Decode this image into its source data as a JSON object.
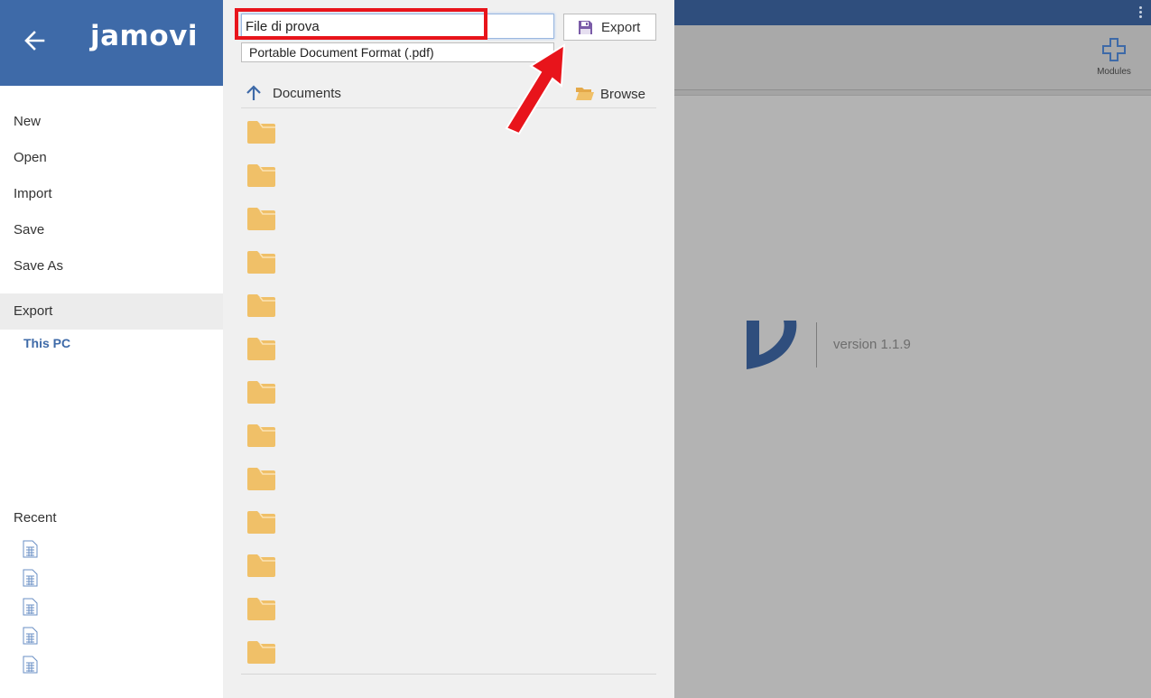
{
  "app": {
    "brand": "jamovi",
    "version": "version 1.1.9",
    "modules_label": "Modules"
  },
  "sidebar": {
    "menu": [
      {
        "label": "New"
      },
      {
        "label": "Open"
      },
      {
        "label": "Import"
      },
      {
        "label": "Save"
      },
      {
        "label": "Save As"
      }
    ],
    "export_label": "Export",
    "this_pc_label": "This PC",
    "recent_title": "Recent"
  },
  "export_panel": {
    "filename_value": "File di prova",
    "format_selected": "Portable Document Format (.pdf)",
    "export_button_label": "Export",
    "current_folder": "Documents",
    "browse_label": "Browse",
    "folder_count": 13
  },
  "colors": {
    "brand_blue": "#3e6aa8",
    "topbar_blue": "#2f4e7d",
    "folder_yellow": "#f0c068",
    "annotation_red": "#e8141b",
    "save_icon_purple": "#7b5ca8"
  }
}
